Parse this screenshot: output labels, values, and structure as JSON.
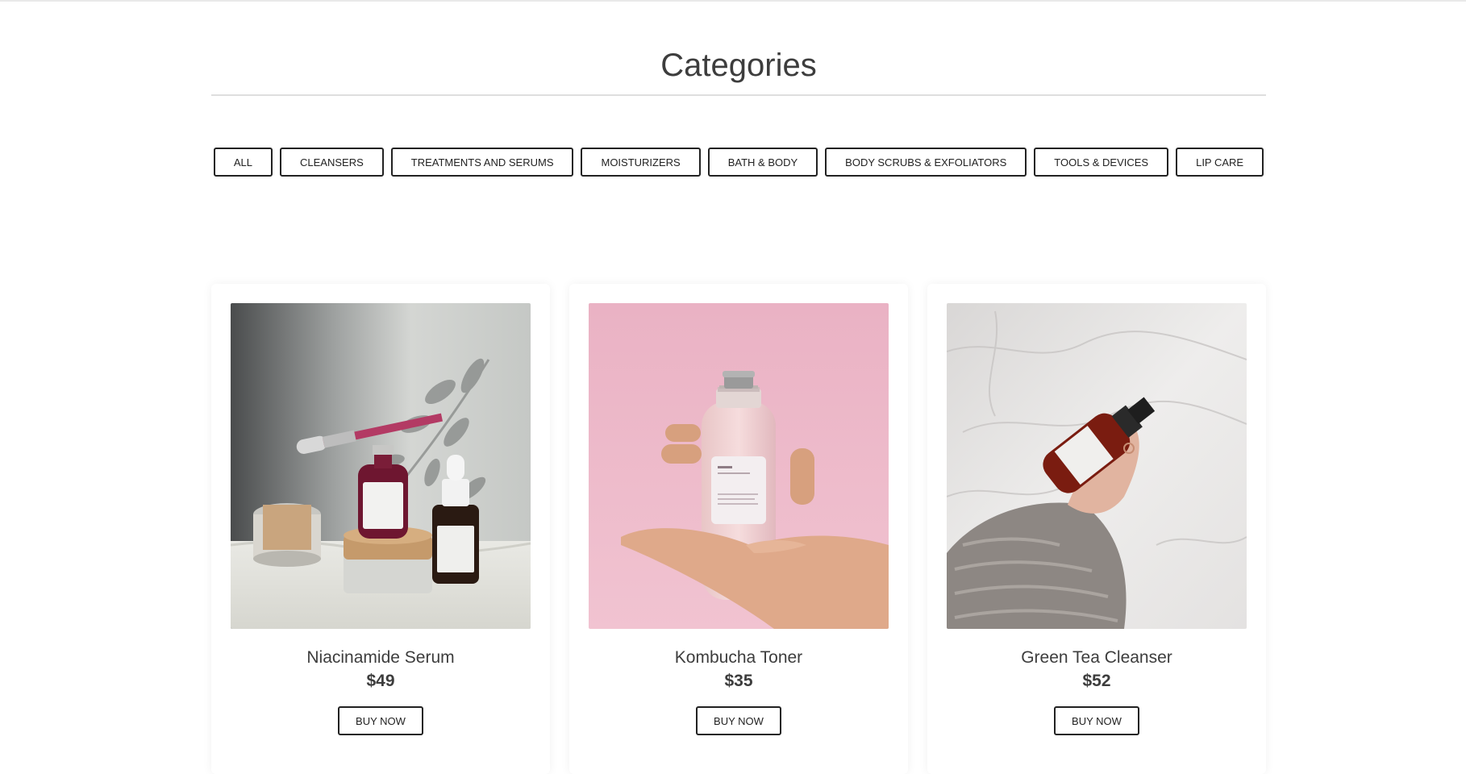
{
  "header": {
    "title": "Categories"
  },
  "filters": [
    {
      "label": "ALL"
    },
    {
      "label": "CLEANSERS"
    },
    {
      "label": "TREATMENTS AND SERUMS"
    },
    {
      "label": "MOISTURIZERS"
    },
    {
      "label": "BATH & BODY"
    },
    {
      "label": "BODY SCRUBS & EXFOLIATORS"
    },
    {
      "label": "TOOLS & DEVICES"
    },
    {
      "label": "LIP CARE"
    }
  ],
  "products": [
    {
      "name": "Niacinamide Serum",
      "price": "$49",
      "button": "BUY NOW"
    },
    {
      "name": "Kombucha Toner",
      "price": "$35",
      "button": "BUY NOW"
    },
    {
      "name": "Green Tea Cleanser",
      "price": "$52",
      "button": "BUY NOW"
    }
  ]
}
